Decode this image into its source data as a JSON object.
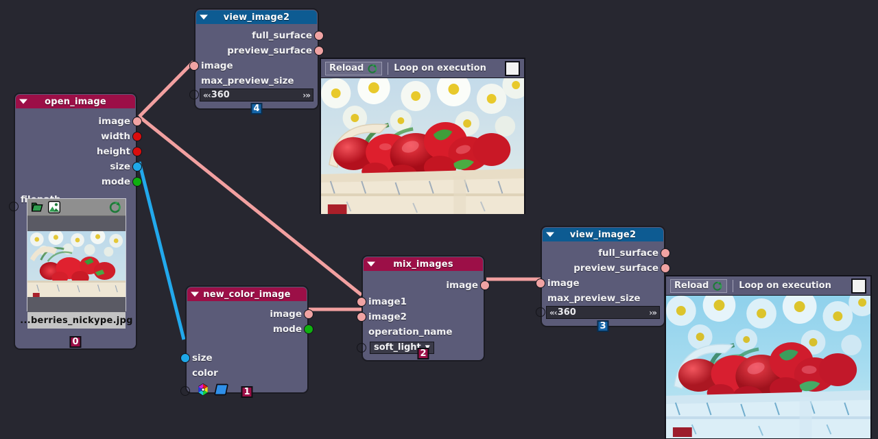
{
  "app": {
    "background_color": "#272730",
    "node_body_color": "#5b5b78",
    "title_red": "#9c0f47",
    "title_blue": "#0d5b92",
    "wire_pink": "#f2a0a0",
    "wire_blue": "#22a9ec"
  },
  "nodes": [
    {
      "id": "open_image",
      "title": "open_image",
      "badge": "0",
      "outputs": [
        "image",
        "width",
        "height",
        "size",
        "mode"
      ],
      "widget_label": "filepath",
      "file_name": "...berries_nickype.jpg"
    },
    {
      "id": "view_image2_top",
      "title": "view_image2",
      "badge": "4",
      "outputs": [
        "full_surface",
        "preview_surface"
      ],
      "inputs": [
        "image",
        "max_preview_size"
      ],
      "max_preview_size": "360"
    },
    {
      "id": "new_color_image",
      "title": "new_color_image",
      "badge": "1",
      "outputs": [
        "image",
        "mode"
      ],
      "inputs": [
        "size",
        "color"
      ]
    },
    {
      "id": "mix_images",
      "title": "mix_images",
      "badge": "2",
      "outputs": [
        "image"
      ],
      "inputs": [
        "image1",
        "image2",
        "operation_name"
      ],
      "operation_name": "soft_light"
    },
    {
      "id": "view_image2_bottom",
      "title": "view_image2",
      "badge": "3",
      "outputs": [
        "full_surface",
        "preview_surface"
      ],
      "inputs": [
        "image",
        "max_preview_size"
      ],
      "max_preview_size": "360"
    }
  ],
  "previews": [
    {
      "id": "preview_top",
      "reload_label": "Reload",
      "loop_label": "Loop on execution",
      "loop_checked": false,
      "image_description": "strawberries in a white wooden basket with daisies behind"
    },
    {
      "id": "preview_bottom",
      "reload_label": "Reload",
      "loop_label": "Loop on execution",
      "loop_checked": false,
      "image_description": "same strawberry basket photo tinted blue by soft_light blend"
    }
  ],
  "icons": {
    "reload": "reload-icon",
    "folder": "folder-icon",
    "image_file": "image-file-icon",
    "color_wheel": "color-wheel-icon",
    "color_swatch": "color-swatch-icon"
  }
}
